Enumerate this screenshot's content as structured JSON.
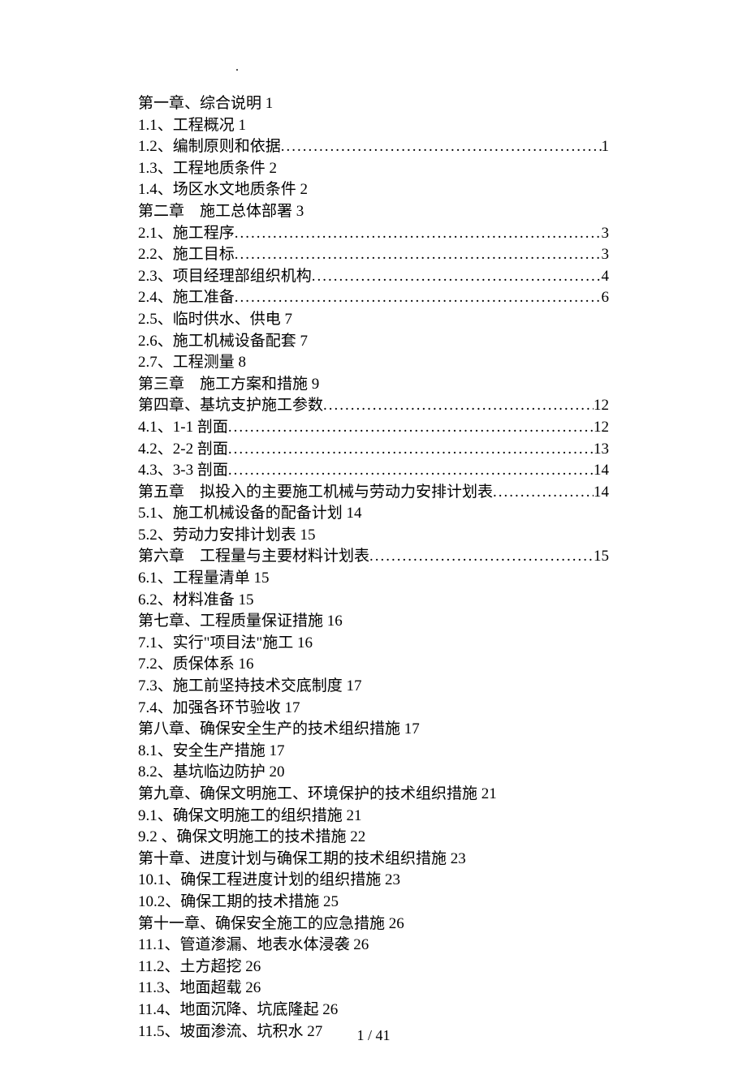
{
  "dot_mark": ".",
  "toc": [
    {
      "label": "第一章、综合说明 1",
      "dotted": false,
      "page": ""
    },
    {
      "label": "1.1、工程概况 1",
      "dotted": false,
      "page": ""
    },
    {
      "label": "1.2、编制原则和依据",
      "dotted": true,
      "page": "1"
    },
    {
      "label": "1.3、工程地质条件 2",
      "dotted": false,
      "page": ""
    },
    {
      "label": "1.4、场区水文地质条件 2",
      "dotted": false,
      "page": ""
    },
    {
      "label": "第二章　施工总体部署 3",
      "dotted": false,
      "page": ""
    },
    {
      "label": "2.1、施工程序",
      "dotted": true,
      "page": "3"
    },
    {
      "label": "2.2、施工目标",
      "dotted": true,
      "page": "3"
    },
    {
      "label": "2.3、项目经理部组织机构",
      "dotted": true,
      "page": "4"
    },
    {
      "label": "2.4、施工准备",
      "dotted": true,
      "page": "6"
    },
    {
      "label": "2.5、临时供水、供电 7",
      "dotted": false,
      "page": ""
    },
    {
      "label": "2.6、施工机械设备配套 7",
      "dotted": false,
      "page": ""
    },
    {
      "label": "2.7、工程测量 8",
      "dotted": false,
      "page": ""
    },
    {
      "label": "第三章　施工方案和措施 9",
      "dotted": false,
      "page": ""
    },
    {
      "label": "第四章、基坑支护施工参数",
      "dotted": true,
      "page": "12"
    },
    {
      "label": "4.1、1-1 剖面 ",
      "dotted": true,
      "page": "12"
    },
    {
      "label": "4.2、2-2 剖面 ",
      "dotted": true,
      "page": "13"
    },
    {
      "label": "4.3、3-3 剖面 ",
      "dotted": true,
      "page": "14"
    },
    {
      "label": "第五章　拟投入的主要施工机械与劳动力安排计划表",
      "dotted": true,
      "page": "14"
    },
    {
      "label": "5.1、施工机械设备的配备计划 14",
      "dotted": false,
      "page": ""
    },
    {
      "label": "5.2、劳动力安排计划表 15",
      "dotted": false,
      "page": ""
    },
    {
      "label": "第六章　工程量与主要材料计划表",
      "dotted": true,
      "page": "15"
    },
    {
      "label": "6.1、工程量清单 15",
      "dotted": false,
      "page": ""
    },
    {
      "label": "6.2、材料准备 15",
      "dotted": false,
      "page": ""
    },
    {
      "label": "第七章、工程质量保证措施 16",
      "dotted": false,
      "page": ""
    },
    {
      "label": "7.1、实行\"项目法\"施工 16",
      "dotted": false,
      "page": ""
    },
    {
      "label": "7.2、质保体系 16",
      "dotted": false,
      "page": ""
    },
    {
      "label": "7.3、施工前坚持技术交底制度 17",
      "dotted": false,
      "page": ""
    },
    {
      "label": "7.4、加强各环节验收 17",
      "dotted": false,
      "page": ""
    },
    {
      "label": "第八章、确保安全生产的技术组织措施 17",
      "dotted": false,
      "page": ""
    },
    {
      "label": "8.1、安全生产措施 17",
      "dotted": false,
      "page": ""
    },
    {
      "label": "8.2、基坑临边防护 20",
      "dotted": false,
      "page": ""
    },
    {
      "label": "第九章、确保文明施工、环境保护的技术组织措施 21",
      "dotted": false,
      "page": ""
    },
    {
      "label": "9.1、确保文明施工的组织措施 21",
      "dotted": false,
      "page": ""
    },
    {
      "label": "9.2 、确保文明施工的技术措施 22",
      "dotted": false,
      "page": ""
    },
    {
      "label": "第十章、进度计划与确保工期的技术组织措施 23",
      "dotted": false,
      "page": ""
    },
    {
      "label": "10.1、确保工程进度计划的组织措施 23",
      "dotted": false,
      "page": ""
    },
    {
      "label": "10.2、确保工期的技术措施 25",
      "dotted": false,
      "page": ""
    },
    {
      "label": "第十一章、确保安全施工的应急措施 26",
      "dotted": false,
      "page": ""
    },
    {
      "label": "11.1、管道渗漏、地表水体浸袭 26",
      "dotted": false,
      "page": ""
    },
    {
      "label": "11.2、土方超挖 26",
      "dotted": false,
      "page": ""
    },
    {
      "label": "11.3、地面超载 26",
      "dotted": false,
      "page": ""
    },
    {
      "label": "11.4、地面沉降、坑底隆起 26",
      "dotted": false,
      "page": ""
    },
    {
      "label": "11.5、坡面渗流、坑积水 27",
      "dotted": false,
      "page": ""
    }
  ],
  "footer": "1 / 41"
}
